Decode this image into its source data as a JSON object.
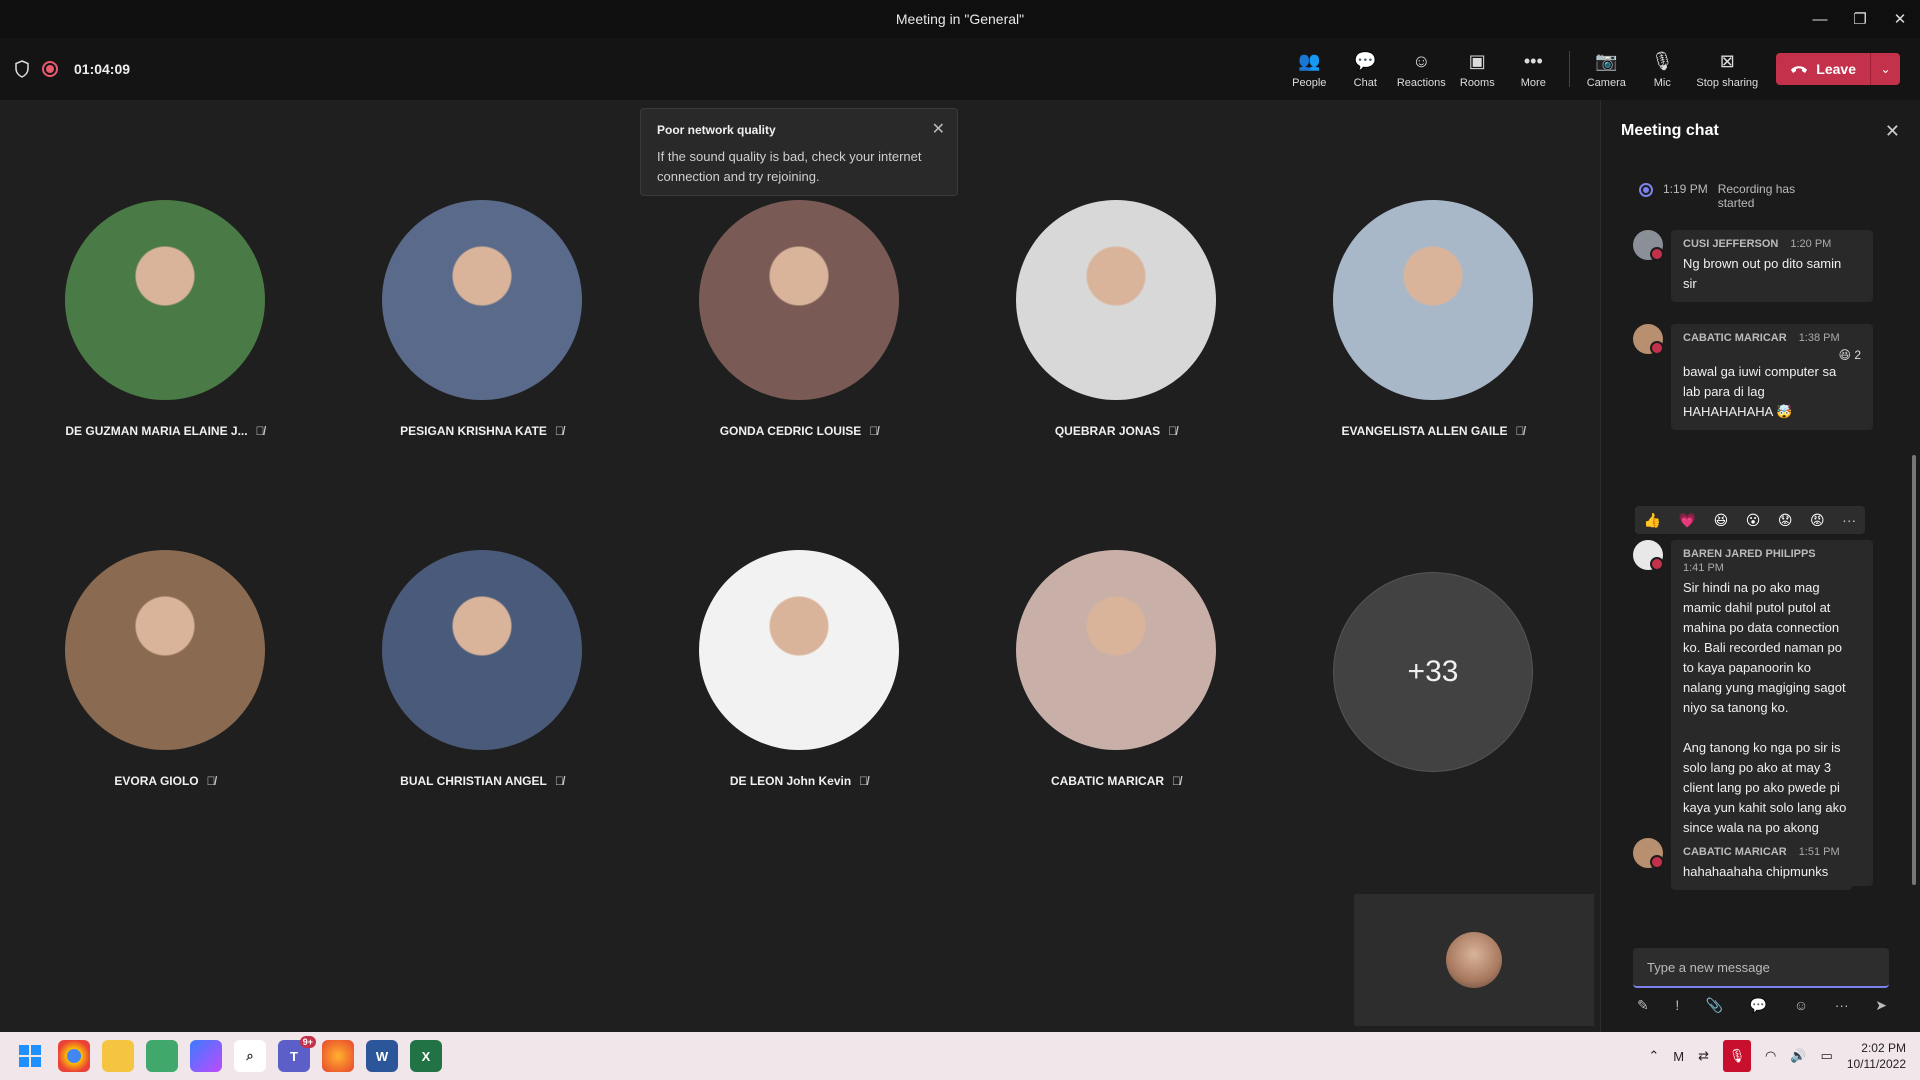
{
  "window": {
    "title": "Meeting in \"General\"",
    "minimize": "—",
    "restore": "❐",
    "close": "✕"
  },
  "toolbar": {
    "timer": "01:04:09",
    "buttons": [
      {
        "label": "People",
        "icon": "👥"
      },
      {
        "label": "Chat",
        "icon": "💬"
      },
      {
        "label": "Reactions",
        "icon": "☺"
      },
      {
        "label": "Rooms",
        "icon": "▣"
      },
      {
        "label": "More",
        "icon": "•••"
      },
      {
        "label": "Camera",
        "icon": "📷"
      },
      {
        "label": "Mic",
        "icon": "🎙"
      },
      {
        "label": "Stop sharing",
        "icon": "⊠"
      }
    ],
    "leave_label": "Leave"
  },
  "toast": {
    "title": "Poor network quality",
    "body": "If the sound quality is bad, check your internet connection and try rejoining."
  },
  "participants": [
    {
      "name": "DE GUZMAN MARIA ELAINE J...",
      "color": "#4a7a45"
    },
    {
      "name": "PESIGAN KRISHNA KATE",
      "color": "#5a6a8a"
    },
    {
      "name": "GONDA CEDRIC LOUISE",
      "color": "#7a5a55"
    },
    {
      "name": "QUEBRAR JONAS",
      "color": "#d8d8d8"
    },
    {
      "name": "EVANGELISTA ALLEN GAILE",
      "color": "#a8b8c8"
    },
    {
      "name": "EVORA GIOLO",
      "color": "#8a6a50"
    },
    {
      "name": "BUAL CHRISTIAN ANGEL",
      "color": "#4a5a7a"
    },
    {
      "name": "DE LEON John Kevin",
      "color": "#f2f2f2"
    },
    {
      "name": "CABATIC MARICAR",
      "color": "#c8b0a8"
    }
  ],
  "overflow_count": "+33",
  "chat": {
    "title": "Meeting chat",
    "system": {
      "time": "1:19 PM",
      "text": "Recording has\nstarted"
    },
    "messages": [
      {
        "sender": "CUSI JEFFERSON",
        "time": "1:20 PM",
        "text": "Ng brown out po dito samin\nsir"
      },
      {
        "sender": "CABATIC MARICAR",
        "time": "1:38 PM",
        "text": "bawal ga iuwi computer sa\nlab para di lag\nHAHAHAHAHA 🤯",
        "reaction": "😆 2"
      },
      {
        "sender": "BAREN JARED PHILIPPS",
        "time": "1:41 PM",
        "text": "Sir hindi na po ako mag\nmamic dahil putol putol at\nmahina po data connection\nko. Bali recorded naman po\nto kaya papanoorin ko\nnalang yung magiging sagot\nniyo sa tanong ko.\n\nAng tanong ko nga po sir is\nsolo lang po ako at may 3\nclient lang po ako pwede pi\nkaya yun kahit solo lang ako\nsince wala na po akong\nmakitang iba. Yun lang po\nsir salamat."
      },
      {
        "sender": "CABATIC MARICAR",
        "time": "1:51 PM",
        "text": "hahahaahaha chipmunks"
      }
    ],
    "reactions": [
      "👍",
      "💗",
      "😆",
      "😮",
      "😟",
      "😡",
      "···"
    ],
    "placeholder": "Type a new message",
    "compose_tools": [
      "✎",
      "!",
      "📎",
      "💬",
      "☺",
      "···",
      "➤"
    ]
  },
  "taskbar": {
    "time": "2:02 PM",
    "date": "10/11/2022",
    "teams_badge": "9+"
  }
}
